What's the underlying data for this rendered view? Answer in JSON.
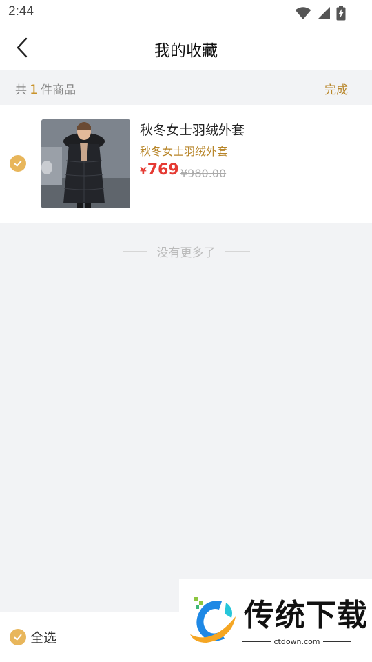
{
  "status_bar": {
    "time": "2:44"
  },
  "header": {
    "title": "我的收藏"
  },
  "count_bar": {
    "prefix": "共",
    "count": "1",
    "suffix": "件商品",
    "done_label": "完成"
  },
  "items": [
    {
      "name": "秋冬女士羽绒外套",
      "subtitle": "秋冬女士羽绒外套",
      "currency": "¥",
      "price": "769",
      "original_price": "¥980.00",
      "selected": true
    }
  ],
  "end_tip": "没有更多了",
  "bottom_bar": {
    "select_all_label": "全选"
  },
  "watermark": {
    "text": "传统下载",
    "url": "ctdown.com"
  },
  "colors": {
    "accent": "#e8b65b",
    "gold_text": "#b8862a",
    "price_red": "#e53a33",
    "background": "#f2f3f5"
  },
  "icons": [
    "wifi-icon",
    "cellular-icon",
    "battery-icon",
    "back-arrow-icon",
    "check-icon"
  ]
}
